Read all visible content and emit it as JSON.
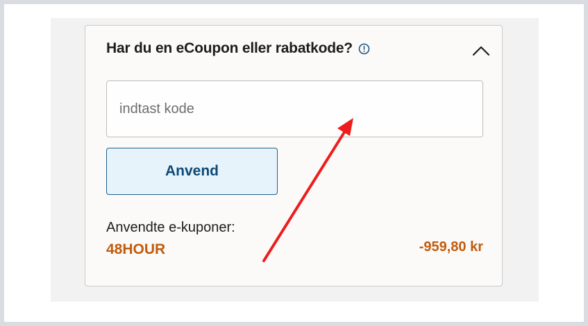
{
  "coupon_section": {
    "title": "Har du en eCoupon eller rabatkode?",
    "info_icon": "info-circle-icon",
    "collapse_icon": "chevron-up-icon",
    "input": {
      "placeholder": "indtast kode",
      "value": ""
    },
    "apply_label": "Anvend",
    "applied_label": "Anvendte e-kuponer:",
    "applied_coupons": [
      {
        "code": "48HOUR",
        "amount": "-959,80 kr"
      }
    ]
  },
  "colors": {
    "accent": "#c25b0c",
    "button_text": "#0d4a78",
    "button_bg": "#e6f3fa",
    "annotation_arrow": "#ee1c1c"
  }
}
